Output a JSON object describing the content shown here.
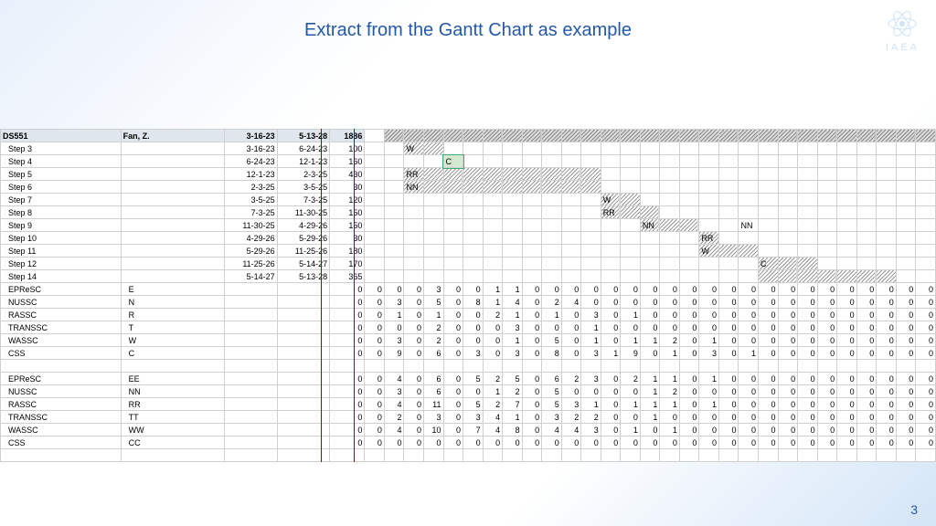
{
  "title": "Extract from the Gantt Chart as example",
  "logo_text": "IAEA",
  "page_number": "3",
  "header": {
    "id": "DS551",
    "owner": "Fan, Z.",
    "start": "3-16-23",
    "end": "5-13-28",
    "dur": "1886"
  },
  "steps": [
    {
      "name": "Step 3",
      "start": "3-16-23",
      "end": "6-24-23",
      "dur": "100",
      "bar": {
        "from": 2,
        "to": 4,
        "label": "W"
      }
    },
    {
      "name": "Step 4",
      "start": "6-24-23",
      "end": "12-1-23",
      "dur": "160",
      "bar": {
        "from": 4,
        "to": 5,
        "label": "C",
        "style": "cbox"
      }
    },
    {
      "name": "Step 5",
      "start": "12-1-23",
      "end": "2-3-25",
      "dur": "430",
      "bar": {
        "from": 2,
        "to": 12,
        "label": "RR"
      }
    },
    {
      "name": "Step 6",
      "start": "2-3-25",
      "end": "3-5-25",
      "dur": "30",
      "bar": {
        "from": 2,
        "to": 12,
        "label": "NN"
      }
    },
    {
      "name": "Step 7",
      "start": "3-5-25",
      "end": "7-3-25",
      "dur": "120",
      "bar": {
        "from": 12,
        "to": 14,
        "label": "W"
      }
    },
    {
      "name": "Step 8",
      "start": "7-3-25",
      "end": "11-30-25",
      "dur": "150",
      "bar": {
        "from": 12,
        "to": 15,
        "label": "RR"
      }
    },
    {
      "name": "Step 9",
      "start": "11-30-25",
      "end": "4-29-26",
      "dur": "150",
      "bar": {
        "from": 14,
        "to": 17,
        "label": "NN",
        "label2": "NN"
      }
    },
    {
      "name": "Step 10",
      "start": "4-29-26",
      "end": "5-29-26",
      "dur": "30",
      "bar": {
        "from": 17,
        "to": 18,
        "label": "RR"
      }
    },
    {
      "name": "Step 11",
      "start": "5-29-26",
      "end": "11-25-26",
      "dur": "180",
      "bar": {
        "from": 17,
        "to": 20,
        "label": "W"
      }
    },
    {
      "name": "Step 12",
      "start": "11-25-26",
      "end": "5-14-27",
      "dur": "170",
      "bar": {
        "from": 20,
        "to": 23,
        "label": "C"
      }
    },
    {
      "name": "Step 14",
      "start": "5-14-27",
      "end": "5-13-28",
      "dur": "365",
      "bar": {
        "from": 20,
        "to": 27,
        "label": ""
      }
    }
  ],
  "committees1": [
    {
      "name": "EPReSC",
      "code": "E",
      "v": [
        0,
        0,
        0,
        3,
        0,
        0,
        1,
        1,
        0,
        0,
        0,
        0,
        0,
        0,
        0,
        0,
        0,
        0,
        0,
        0,
        0,
        0,
        0,
        0,
        0,
        0
      ]
    },
    {
      "name": "NUSSC",
      "code": "N",
      "v": [
        0,
        3,
        0,
        5,
        0,
        8,
        1,
        4,
        0,
        2,
        4,
        0,
        0,
        0,
        0,
        0,
        0,
        0,
        0,
        0,
        0,
        0,
        0,
        0,
        0,
        0
      ]
    },
    {
      "name": "RASSC",
      "code": "R",
      "v": [
        0,
        1,
        0,
        1,
        0,
        0,
        2,
        1,
        0,
        1,
        0,
        3,
        0,
        1,
        0,
        0,
        0,
        0,
        0,
        0,
        0,
        0,
        0,
        0,
        0,
        0
      ]
    },
    {
      "name": "TRANSSC",
      "code": "T",
      "v": [
        0,
        0,
        0,
        2,
        0,
        0,
        0,
        3,
        0,
        0,
        0,
        1,
        0,
        0,
        0,
        0,
        0,
        0,
        0,
        0,
        0,
        0,
        0,
        0,
        0,
        0
      ]
    },
    {
      "name": "WASSC",
      "code": "W",
      "v": [
        0,
        3,
        0,
        2,
        0,
        0,
        0,
        1,
        0,
        5,
        0,
        1,
        0,
        1,
        1,
        2,
        0,
        1,
        0,
        0,
        0,
        0,
        0,
        0,
        0,
        0
      ]
    },
    {
      "name": "CSS",
      "code": "C",
      "v": [
        0,
        9,
        0,
        6,
        0,
        3,
        0,
        3,
        0,
        8,
        0,
        3,
        1,
        9,
        0,
        1,
        0,
        3,
        0,
        1,
        0,
        0,
        0,
        0,
        0,
        0
      ]
    }
  ],
  "committees2": [
    {
      "name": "EPReSC",
      "code": "EE",
      "v": [
        0,
        4,
        0,
        6,
        0,
        5,
        2,
        5,
        0,
        6,
        2,
        3,
        0,
        2,
        1,
        1,
        0,
        1,
        0,
        0,
        0,
        0,
        0,
        0,
        0,
        0
      ]
    },
    {
      "name": "NUSSC",
      "code": "NN",
      "v": [
        0,
        3,
        0,
        6,
        0,
        0,
        1,
        2,
        0,
        5,
        0,
        0,
        0,
        0,
        1,
        2,
        0,
        0,
        0,
        0,
        0,
        0,
        0,
        0,
        0,
        0
      ]
    },
    {
      "name": "RASSC",
      "code": "RR",
      "v": [
        0,
        4,
        0,
        11,
        0,
        5,
        2,
        7,
        0,
        5,
        3,
        1,
        0,
        1,
        1,
        1,
        0,
        1,
        0,
        0,
        0,
        0,
        0,
        0,
        0,
        0
      ]
    },
    {
      "name": "TRANSSC",
      "code": "TT",
      "v": [
        0,
        2,
        0,
        3,
        0,
        3,
        4,
        1,
        0,
        3,
        2,
        2,
        0,
        0,
        1,
        0,
        0,
        0,
        0,
        0,
        0,
        0,
        0,
        0,
        0,
        0
      ]
    },
    {
      "name": "WASSC",
      "code": "WW",
      "v": [
        0,
        4,
        0,
        10,
        0,
        7,
        4,
        8,
        0,
        4,
        4,
        3,
        0,
        1,
        0,
        1,
        0,
        0,
        0,
        0,
        0,
        0,
        0,
        0,
        0,
        0
      ]
    },
    {
      "name": "CSS",
      "code": "CC",
      "v": [
        0,
        0,
        0,
        0,
        0,
        0,
        0,
        0,
        0,
        0,
        0,
        0,
        0,
        0,
        0,
        0,
        0,
        0,
        0,
        0,
        0,
        0,
        0,
        0,
        0,
        0
      ]
    }
  ],
  "timeline_cols": 29,
  "marker1_col": 1,
  "marker2_col": 3,
  "chart_data": {
    "type": "gantt",
    "title": "Extract from the Gantt Chart as example",
    "x_start": "2023-03",
    "x_end": "2028-05",
    "tasks": [
      {
        "name": "Step 3",
        "start": "2023-03-16",
        "end": "2023-06-24",
        "dur": 100,
        "label": "W"
      },
      {
        "name": "Step 4",
        "start": "2023-06-24",
        "end": "2023-12-01",
        "dur": 160,
        "label": "C"
      },
      {
        "name": "Step 5",
        "start": "2023-12-01",
        "end": "2025-02-03",
        "dur": 430,
        "label": "RR"
      },
      {
        "name": "Step 6",
        "start": "2025-02-03",
        "end": "2025-03-05",
        "dur": 30,
        "label": "NN"
      },
      {
        "name": "Step 7",
        "start": "2025-03-05",
        "end": "2025-07-03",
        "dur": 120,
        "label": "W"
      },
      {
        "name": "Step 8",
        "start": "2025-07-03",
        "end": "2025-11-30",
        "dur": 150,
        "label": "RR"
      },
      {
        "name": "Step 9",
        "start": "2025-11-30",
        "end": "2026-04-29",
        "dur": 150,
        "label": "NN"
      },
      {
        "name": "Step 10",
        "start": "2026-04-29",
        "end": "2026-05-29",
        "dur": 30,
        "label": "RR"
      },
      {
        "name": "Step 11",
        "start": "2026-05-29",
        "end": "2026-11-25",
        "dur": 180,
        "label": "W"
      },
      {
        "name": "Step 12",
        "start": "2026-11-25",
        "end": "2027-05-14",
        "dur": 170,
        "label": "C"
      },
      {
        "name": "Step 14",
        "start": "2027-05-14",
        "end": "2028-05-13",
        "dur": 365
      }
    ]
  }
}
